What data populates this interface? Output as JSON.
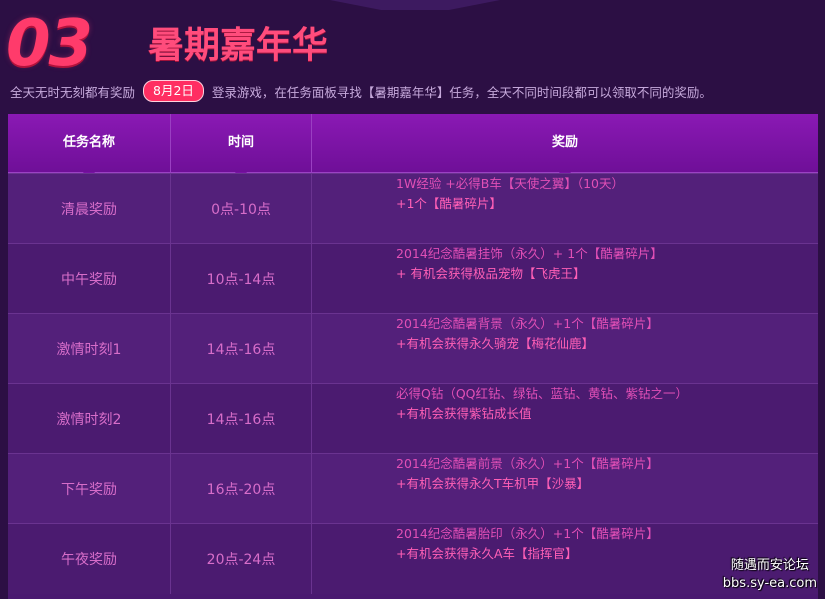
{
  "header": {
    "number": "03",
    "title": "暑期嘉年华",
    "intro_before": "全天无时无刻都有奖励",
    "date_badge": "8月2日",
    "intro_after": "登录游戏，在任务面板寻找【暑期嘉年华】任务，全天不同时间段都可以领取不同的奖励。"
  },
  "table": {
    "headers": [
      "任务名称",
      "时间",
      "奖励"
    ],
    "rows": [
      {
        "name": "清晨奖励",
        "time": "0点-10点",
        "reward_line1": "1W经验 +必得B车【天使之翼】（10天）",
        "reward_line2": "+1个【酷暑碎片】"
      },
      {
        "name": "中午奖励",
        "time": "10点-14点",
        "reward_line1": "2014纪念酷暑挂饰（永久）+ 1个【酷暑碎片】",
        "reward_line2": "+ 有机会获得极品宠物【飞虎王】"
      },
      {
        "name": "激情时刻1",
        "time": "14点-16点",
        "reward_line1": "2014纪念酷暑背景（永久）+1个【酷暑碎片】",
        "reward_line2": "+有机会获得永久骑宠【梅花仙鹿】"
      },
      {
        "name": "激情时刻2",
        "time": "14点-16点",
        "reward_line1": "必得Q钻（QQ红钻、绿钻、蓝钻、黄钻、紫钻之一）",
        "reward_line2": "+有机会获得紫钻成长值"
      },
      {
        "name": "下午奖励",
        "time": "16点-20点",
        "reward_line1": "2014纪念酷暑前景（永久）+1个【酷暑碎片】",
        "reward_line2": "+有机会获得永久T车机甲【沙暴】"
      },
      {
        "name": "午夜奖励",
        "time": "20点-24点",
        "reward_line1": "2014纪念酷暑胎印（永久）+1个【酷暑碎片】",
        "reward_line2": "+有机会获得永久A车【指挥官】"
      }
    ]
  },
  "watermark": {
    "line1": "随遇而安论坛",
    "line2": "bbs.sy-ea.com"
  },
  "colors": {
    "background": "#2c0f44",
    "accent": "#ff3b6b",
    "header_row": "#7a13a5",
    "reward_text": "#e14fb6"
  }
}
